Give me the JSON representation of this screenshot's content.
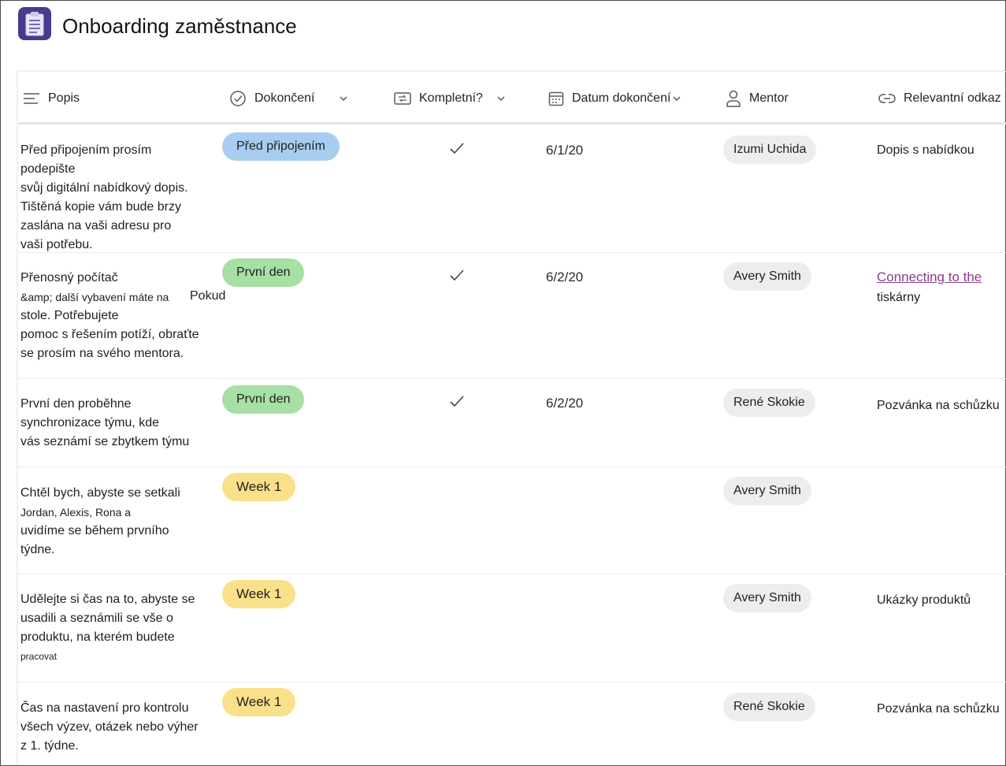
{
  "app": {
    "title": "Onboarding zaměstnance",
    "logo_icon": "clipboard-icon",
    "accent_color": "#4a3a8c"
  },
  "columns": [
    {
      "label": "Popis",
      "icon": "text-lines-icon"
    },
    {
      "label": "Dokončení",
      "icon": "check-circle-icon",
      "has_dropdown": true
    },
    {
      "label": "Kompletní?",
      "icon": "toggle-icon",
      "has_dropdown": true
    },
    {
      "label": "Datum dokončení",
      "icon": "calendar-icon",
      "has_dropdown": true
    },
    {
      "label": "Mentor",
      "icon": "person-icon"
    },
    {
      "label": "Relevantní odkaz",
      "icon": "link-icon"
    }
  ],
  "rows": [
    {
      "description": [
        "Před připojením prosím podepište",
        "svůj digitální nabídkový dopis.",
        "Tištěná kopie vám bude brzy",
        "zaslána na vaši adresu pro",
        "vaši potřebu."
      ],
      "completion": "Před připojením",
      "completion_color": "#a7cdf0",
      "complete": true,
      "date": "6/1/20",
      "mentor": "Izumi Uchida",
      "link": "Dopis s nabídkou"
    },
    {
      "description": [
        "Přenosný počítač",
        "&amp; další vybavení máte na",
        "stole. Potřebujete",
        "pomoc s řešením potíží, obraťte",
        "se prosím na svého mentora."
      ],
      "side_note": "Pokud",
      "completion": "První den",
      "completion_color": "#a6e0a4",
      "complete": true,
      "date": "6/2/20",
      "mentor": "Avery Smith",
      "link_hyper": "Connecting to the",
      "link_rest": "tiskárny"
    },
    {
      "description": [
        "První den proběhne",
        "synchronizace týmu, kde",
        "vás seznámí se zbytkem týmu"
      ],
      "completion": "První den",
      "completion_color": "#a6e0a4",
      "complete": true,
      "date": "6/2/20",
      "mentor": "René Skokie",
      "link": "Pozvánka na schůzku"
    },
    {
      "description": [
        "Chtěl bych, abyste se setkali",
        "Jordan, Alexis, Rona a",
        "uvidíme se během prvního",
        "týdne."
      ],
      "completion": "Week 1",
      "completion_color": "#fbe08a",
      "complete": false,
      "date": "",
      "mentor": "Avery Smith",
      "link": ""
    },
    {
      "description": [
        "Udělejte si čas na to, abyste se",
        "usadili a seznámili se vše o",
        "produktu, na kterém budete",
        "pracovat"
      ],
      "completion": "Week 1",
      "completion_color": "#fbe08a",
      "complete": false,
      "date": "",
      "mentor": "Avery Smith",
      "link": "Ukázky produktů"
    },
    {
      "description": [
        "Čas na nastavení pro kontrolu",
        "všech výzev, otázek nebo výher",
        "z 1. týdne."
      ],
      "completion": "Week 1",
      "completion_color": "#fbe08a",
      "complete": false,
      "date": "",
      "mentor": "René Skokie",
      "link": "Pozvánka na schůzku"
    }
  ]
}
